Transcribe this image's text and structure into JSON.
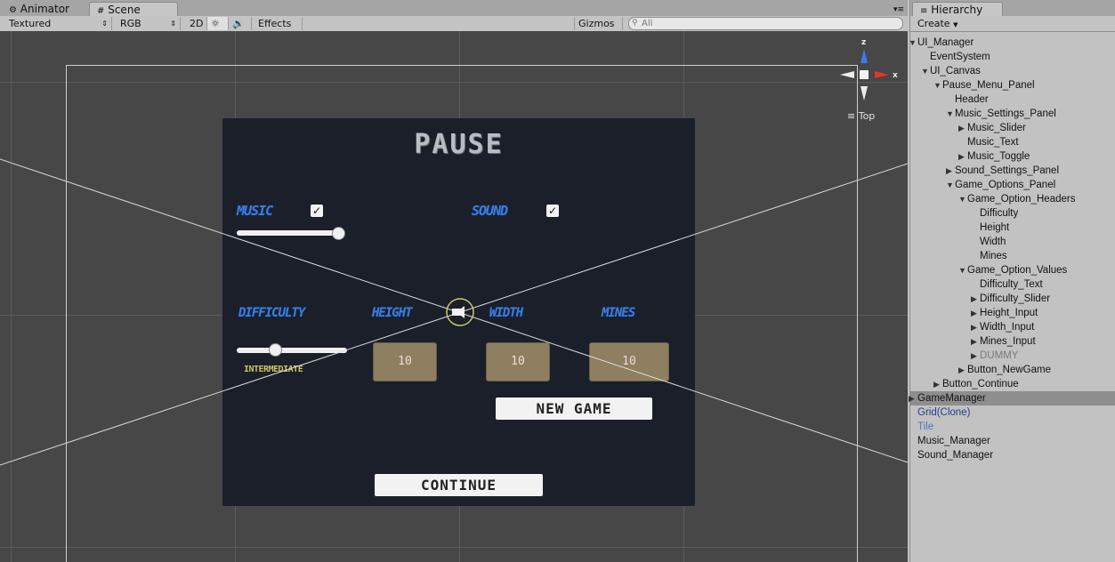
{
  "tabs": [
    {
      "label": "Animator",
      "icon": "animator-icon"
    },
    {
      "label": "Scene",
      "icon": "scene-grid-icon"
    }
  ],
  "toolbar": {
    "shading_mode": "Textured",
    "color_mode": "RGB",
    "mode_2d": "2D",
    "effects": "Effects",
    "gizmos": "Gizmos",
    "search_placeholder": "All"
  },
  "gizmo": {
    "y_label": "z",
    "x_label": "x",
    "view_label": "Top"
  },
  "pause_menu": {
    "title": "PAUSE",
    "music_label": "MUSIC",
    "music_checked": true,
    "sound_label": "SOUND",
    "sound_checked": true,
    "music_volume": 0.95,
    "headers": [
      "DIFFICULTY",
      "HEIGHT",
      "WIDTH",
      "MINES"
    ],
    "difficulty_value": 0.35,
    "difficulty_text": "INTERMEDIATE",
    "height_value": "10",
    "width_value": "10",
    "mines_value": "10",
    "new_game_label": "NEW GAME",
    "continue_label": "CONTINUE"
  },
  "hierarchy": {
    "tab_label": "Hierarchy",
    "create_label": "Create",
    "items": [
      {
        "label": "UI_Manager",
        "arrow": "down",
        "depth": 0
      },
      {
        "label": "EventSystem",
        "arrow": "",
        "depth": 1
      },
      {
        "label": "UI_Canvas",
        "arrow": "down",
        "depth": 1
      },
      {
        "label": "Pause_Menu_Panel",
        "arrow": "down",
        "depth": 2
      },
      {
        "label": "Header",
        "arrow": "",
        "depth": 3
      },
      {
        "label": "Music_Settings_Panel",
        "arrow": "down",
        "depth": 3
      },
      {
        "label": "Music_Slider",
        "arrow": "right",
        "depth": 4
      },
      {
        "label": "Music_Text",
        "arrow": "",
        "depth": 4
      },
      {
        "label": "Music_Toggle",
        "arrow": "right",
        "depth": 4
      },
      {
        "label": "Sound_Settings_Panel",
        "arrow": "right",
        "depth": 3
      },
      {
        "label": "Game_Options_Panel",
        "arrow": "down",
        "depth": 3
      },
      {
        "label": "Game_Option_Headers",
        "arrow": "down",
        "depth": 4
      },
      {
        "label": "Difficulty",
        "arrow": "",
        "depth": 5
      },
      {
        "label": "Height",
        "arrow": "",
        "depth": 5
      },
      {
        "label": "Width",
        "arrow": "",
        "depth": 5
      },
      {
        "label": "Mines",
        "arrow": "",
        "depth": 5
      },
      {
        "label": "Game_Option_Values",
        "arrow": "down",
        "depth": 4
      },
      {
        "label": "Difficulty_Text",
        "arrow": "",
        "depth": 5
      },
      {
        "label": "Difficulty_Slider",
        "arrow": "right",
        "depth": 5
      },
      {
        "label": "Height_Input",
        "arrow": "right",
        "depth": 5
      },
      {
        "label": "Width_Input",
        "arrow": "right",
        "depth": 5
      },
      {
        "label": "Mines_Input",
        "arrow": "right",
        "depth": 5
      },
      {
        "label": "DUMMY",
        "arrow": "right",
        "depth": 5,
        "style": "disabled"
      },
      {
        "label": "Button_NewGame",
        "arrow": "right",
        "depth": 4
      },
      {
        "label": "Button_Continue",
        "arrow": "right",
        "depth": 2
      },
      {
        "label": "GameManager",
        "arrow": "right",
        "depth": 0,
        "style": "selected"
      },
      {
        "label": "Grid(Clone)",
        "arrow": "",
        "depth": 0,
        "style": "prefab"
      },
      {
        "label": "Tile",
        "arrow": "",
        "depth": 0,
        "style": "prefab-light"
      },
      {
        "label": "Music_Manager",
        "arrow": "",
        "depth": 0
      },
      {
        "label": "Sound_Manager",
        "arrow": "",
        "depth": 0
      }
    ]
  },
  "colors": {
    "scene_bg": "#474747",
    "panel_bg": "#1a1f29",
    "label_blue": "#3a7de0",
    "input_brown": "#8e7f61",
    "selected_row": "#8e8e8e"
  }
}
